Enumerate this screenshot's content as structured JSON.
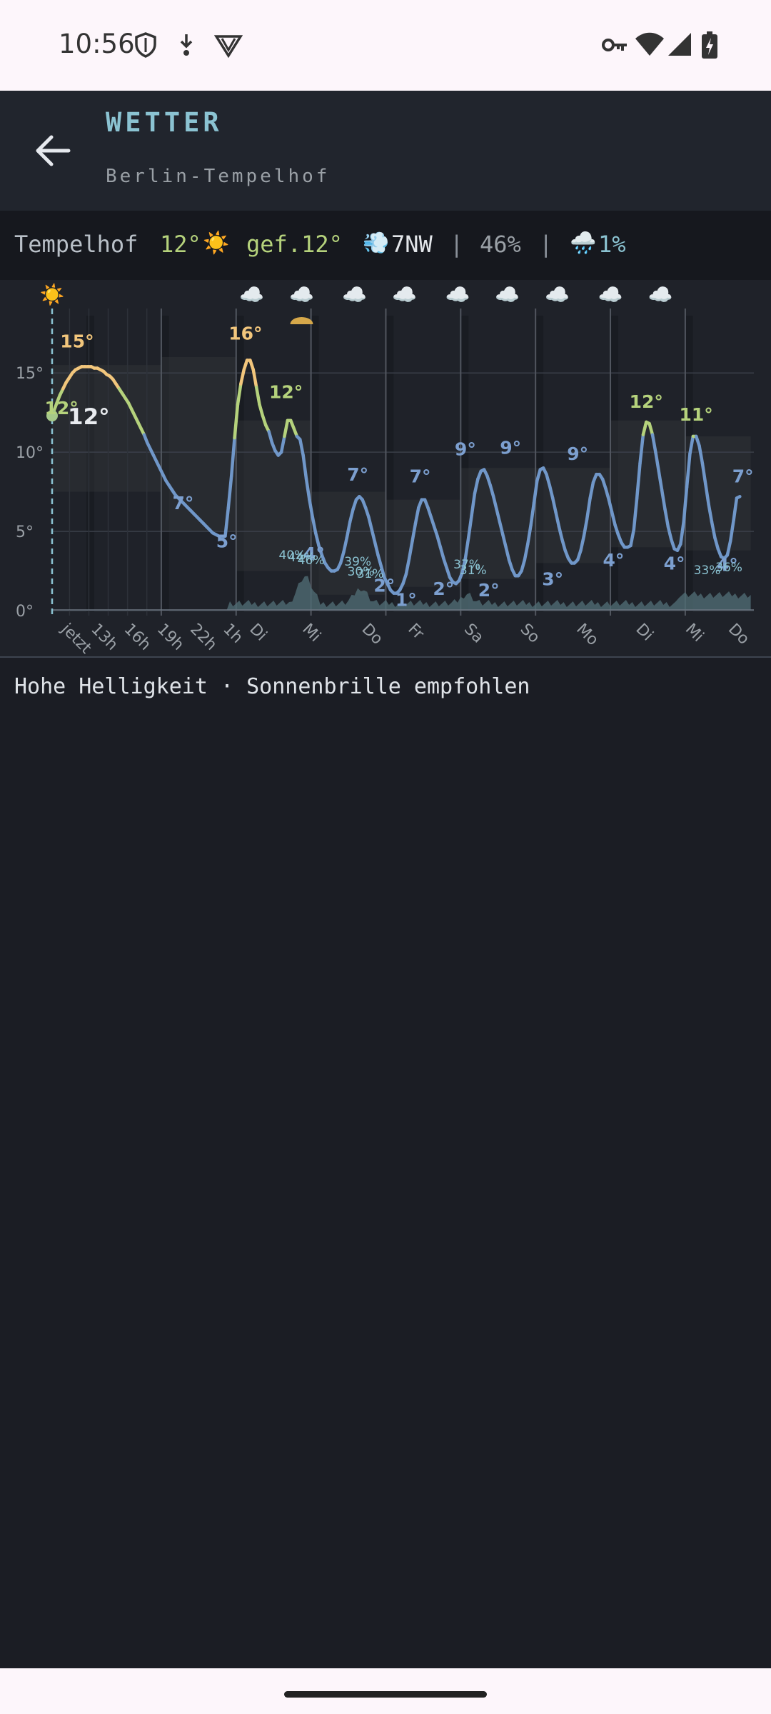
{
  "status_bar": {
    "time": "10:56"
  },
  "app_bar": {
    "title": "WETTER",
    "subtitle": "Berlin-Tempelhof"
  },
  "summary": {
    "location": "Tempelhof",
    "temperature": "12°",
    "condition_icon": "☀️",
    "feels_like": "gef.12°",
    "wind_icon": "💨",
    "wind": "7NW",
    "sep1": "|",
    "humidity": "46%",
    "sep2": "|",
    "rain_icon": "🌧️",
    "precipitation": "1%"
  },
  "advice": "Hohe Helligkeit · Sonnenbrille empfohlen",
  "colors": {
    "background": "#1b1d24",
    "accent": "#8bc3d2",
    "warm": "#f2c67c",
    "mild": "#b5d27c",
    "cool": "#7097c9"
  },
  "chart_data": {
    "type": "line",
    "ylim": [
      -1,
      17
    ],
    "y_ticks": [
      "15°",
      "10°",
      "5°",
      "0°"
    ],
    "x_ticks": [
      "jetzt",
      "13h",
      "16h",
      "19h",
      "22h",
      "1h",
      "Di",
      "Mi",
      "Do",
      "Fr",
      "Sa",
      "So",
      "Mo",
      "Di",
      "Mi",
      "Do"
    ],
    "temperature": {
      "x": [
        0,
        1.5,
        2.5,
        3.5,
        4.5,
        5.5,
        6.5,
        7.5,
        8.5,
        9.5,
        10.5,
        11.5,
        12.5,
        13.5,
        14.5,
        15.5,
        16.5,
        17.5,
        18.5,
        19.5,
        20.5,
        21.5,
        22.5,
        23.5,
        24.5,
        25.5,
        26.5,
        27.5,
        28.5,
        29.5,
        30.5,
        31.5,
        32.5,
        33.5,
        34.5,
        35.5,
        36.5,
        37.5,
        38.5,
        39.5,
        40.5,
        41.5,
        42.5,
        43.5,
        44.5,
        45.5,
        46.5,
        47.5,
        48.5,
        49.5,
        50.5,
        51.5,
        52.5,
        53.5,
        54.5,
        55.5,
        56.5,
        57.5,
        58.5,
        59.5,
        60.5,
        61.5,
        62.5,
        63.5,
        64.5,
        65.5,
        66.5,
        67.5,
        68.5,
        69.5,
        70.5,
        71.5,
        72.5,
        73.5,
        74.5,
        75.5,
        76.5,
        77.5,
        78.5,
        79.5,
        80.5,
        81.5,
        82.5,
        83.5,
        84.5,
        85.5,
        86.5,
        87.5,
        88.5,
        89.5,
        90.5,
        91.5,
        92.5,
        93.5,
        94.5,
        95.5,
        96.5,
        97.5,
        98.5,
        99.5,
        100.5,
        101.5,
        102.5,
        103.5,
        104.5,
        105.5,
        106.5,
        107.5,
        108.5,
        109.5,
        110.5,
        111.5,
        112.5,
        113.5,
        114.5,
        115.5,
        116.5,
        117.5,
        118.5,
        119.5,
        120.5,
        121.5,
        122.5,
        123.5,
        124.5,
        125.5,
        126.5,
        127.5,
        128.5,
        129.5,
        130.5,
        131.5,
        132.5,
        133.5,
        134.5,
        135.5,
        136.5,
        137.5,
        138.5,
        139.5,
        140.5,
        141.5,
        142.5,
        143.5,
        144.5,
        145.5,
        146.5,
        147.5,
        148.5,
        149.5,
        150.5,
        151.5,
        152.5,
        153.5,
        154.5,
        155.5,
        156.5,
        157.5,
        158.5,
        159.5,
        160.5,
        161.5,
        162.5,
        163.5,
        164.5,
        165.5,
        166.5,
        167.5,
        168.5,
        169.5,
        170.5,
        171.5,
        172.5,
        173.5,
        174.5,
        175.5,
        176.5,
        177.5,
        178.5,
        179.5,
        180.5,
        181.5,
        182.5,
        183.5,
        184.5,
        185.5,
        186.5,
        187.5,
        188.5,
        189.5,
        190.5,
        191.5,
        192.5,
        193.5,
        194.5,
        195.5,
        196.5,
        197.5,
        198.5,
        199.5,
        200.5,
        201.5,
        202.5,
        203.5,
        204.5,
        205.5,
        206.5,
        207.5,
        208.5,
        209.5,
        210.5,
        211.5,
        212.5,
        213.5,
        214.5,
        215.5,
        216.5,
        217.5,
        218.5,
        219.5,
        220.5,
        221.5,
        222.5,
        223.5,
        224.5,
        225.5,
        226.5,
        227.5,
        228.5,
        229.5,
        230.5,
        231.5,
        232.5,
        233.5,
        234.5,
        235.5,
        236.5,
        237.5,
        238.5,
        239.5,
        240.5,
        241.5,
        242.5,
        243.5,
        244.5,
        245.5,
        246.5,
        247.5,
        248.5,
        249.5,
        250.5,
        251.5,
        252.5,
        253.5,
        254.5,
        255.5,
        256.5,
        257.5,
        258.5,
        259.5,
        260.5,
        261.5,
        262.5,
        263.5,
        264.5,
        265.5,
        266.5,
        267.5,
        268.5,
        269.5,
        270.5,
        271.5,
        272.5,
        273.5,
        274.5,
        275.5,
        276.5,
        277.5,
        278.5,
        279.5,
        280.5,
        281.5,
        282.5,
        283.5,
        284.5,
        285.5,
        286.5,
        287.5,
        288.5,
        289.5,
        290.5,
        291.5,
        292.5,
        293.5,
        294.5,
        295.5,
        296.5,
        297.5,
        298.5,
        299.5,
        300.5,
        301.5,
        302.5,
        303.5,
        304.5,
        305.5,
        306.5,
        307.5,
        308.5,
        309.5,
        310.5,
        311.5,
        312.5,
        313.5,
        314.5,
        315.5,
        316.5,
        317.5,
        318.5,
        319.5,
        320.5,
        321.5,
        322.5,
        323.5,
        324.5,
        325.5,
        326.5,
        327.5,
        328.5,
        329.5,
        330.5,
        331.5,
        332.5,
        333.5,
        334.5,
        335.5,
        336.5,
        337.5,
        338.5,
        339.5,
        340.5,
        341.5,
        342.5,
        343.5,
        344.5,
        345.5,
        346.5,
        347.5,
        348.5,
        349.5,
        350.5,
        351.5,
        352.5,
        353.5,
        354.5,
        355.5,
        356.5,
        357.5,
        358.5,
        359.5,
        360.5,
        361.5,
        362.5,
        363.5,
        364.5,
        365.5,
        366.5,
        367.5,
        368.5,
        369.5,
        370.5,
        371.5,
        372.5,
        373.5,
        374.5,
        375.5,
        376.5,
        377.5,
        378.5,
        379.5,
        380.5,
        381.5,
        382.5,
        383.5,
        384.5,
        385.5,
        386.5,
        387.5,
        388.5,
        389.5,
        390.5,
        391.5,
        392.5,
        393.5,
        394.5,
        395.5,
        396.5,
        397.5,
        398.5,
        399.5,
        400.5,
        401.5,
        402.5,
        403.5,
        404.5,
        405.5,
        406.5,
        407.5,
        408.5,
        409.5,
        410.5,
        411.5,
        412.5,
        413.5,
        414.5,
        415.5,
        416.5,
        417.5,
        418.5,
        419.5,
        420.5,
        421.5,
        422.5,
        423.5,
        424.5,
        425.5,
        426.5,
        427.5,
        428.5,
        429.5,
        430.5,
        431.5,
        432.5,
        433.5,
        434.5,
        435.5,
        436.5,
        437.5,
        438.5,
        439.5,
        440.5,
        441.5,
        442.5,
        443.5,
        444.5,
        445.5,
        446.5,
        447.5,
        448.5,
        449.5,
        450.5,
        451.5,
        452.5,
        453.5,
        454.5,
        455.5,
        456.5,
        457.5,
        458.5,
        459.5,
        460.5,
        461.5,
        462.5,
        463.5,
        464.5,
        465.5,
        466.5,
        467.5,
        468.5,
        469.5,
        470.5,
        471.5,
        472.5,
        473.5,
        474.5,
        475.5,
        476.5,
        477.5,
        478.5,
        479.5,
        480.5,
        481.5,
        482.5,
        483.5,
        484.5,
        485.5,
        486.5,
        487.5,
        488.5,
        489.5,
        490.5,
        491.5,
        492.5,
        493.5,
        494.5,
        495.5,
        496.5,
        497.5,
        498.5,
        499.5,
        500.5,
        501.5,
        502.5,
        503.5,
        504.5,
        505.5,
        506.5,
        507.5,
        508.5,
        509.5,
        510.5,
        511.5,
        512.5,
        513.5,
        514.5,
        515.5,
        516.5,
        517.5,
        518.5,
        519.5,
        520.5,
        521.5,
        522.5,
        523.5,
        524.5,
        525.5,
        526.5,
        527.5,
        528.5,
        529.5,
        530.5,
        531.5,
        532.5,
        533.5,
        534.5,
        535.5,
        536.5,
        537.5,
        538.5,
        539.5,
        540.5,
        541.5,
        542.5,
        543.5,
        544.5,
        545.5,
        546.5,
        547.5,
        548.5,
        549.5,
        550.5,
        551.5,
        552.5,
        553.5,
        554.5,
        555.5,
        556.5,
        557.5,
        558.5,
        559.5,
        560.5,
        561.5,
        562.5,
        563.5,
        564.5,
        565.5,
        566.5,
        567.5,
        568.5,
        569.5,
        570.5,
        571.5,
        572.5,
        573.5,
        574.5,
        575.5,
        576.5,
        577.5,
        578.5,
        579.5,
        580.5,
        581.5,
        582.5,
        583.5,
        584.5,
        585.5,
        586.5,
        587.5,
        588.5,
        589.5,
        590.5,
        591.5,
        592.5,
        593.5,
        594.5,
        595.5,
        596.5,
        597.5,
        598.5,
        599.5,
        600.5,
        601.5,
        602.5,
        603.5,
        604.5,
        605.5,
        606.5,
        607.5,
        608.5,
        609.5,
        610.5,
        611.5,
        612.5,
        613.5,
        614.5,
        615.5,
        616.5,
        617.5,
        618.5,
        619.5,
        620.5,
        621.5,
        622.5,
        623.5,
        624.5,
        625.5,
        626.5,
        627.5,
        628.5,
        629.5,
        630.5,
        631.5,
        632.5,
        633.5,
        634.5,
        635.5,
        636.5,
        637.5,
        638.5,
        639.5
      ],
      "y": [
        12.3,
        13.1,
        13.6,
        14.0,
        14.4,
        14.7,
        15.0,
        15.2,
        15.3,
        15.4,
        15.4,
        15.4,
        15.4,
        15.3,
        15.3,
        15.2,
        15.1,
        14.9,
        14.8,
        14.6,
        14.3,
        14.0,
        13.7,
        13.4,
        13.1,
        12.7,
        12.3,
        11.9,
        11.5,
        11.1,
        10.6,
        10.2,
        9.8,
        9.4,
        9.0,
        8.6,
        8.2,
        7.9,
        7.6,
        7.3,
        7.1,
        6.9,
        6.7,
        6.5,
        6.3,
        6.1,
        5.9,
        5.7,
        5.5,
        5.3,
        5.1,
        4.9,
        4.8,
        4.7,
        4.6,
        4.7,
        6.5,
        8.5,
        10.9,
        13.0,
        14.3,
        15.2,
        15.8,
        15.8,
        15.2,
        14.1,
        13.0,
        12.3,
        11.7,
        11.3,
        10.6,
        10.1,
        9.8,
        10.0,
        11.0,
        12.0,
        12.0,
        11.5,
        11.0,
        10.8,
        9.8,
        8.3,
        7.0,
        5.9,
        4.9,
        4.1,
        3.5,
        3.0,
        2.7,
        2.5,
        2.5,
        2.6,
        3.0,
        3.7,
        4.6,
        5.6,
        6.4,
        7.0,
        7.2,
        7.0,
        6.5,
        5.9,
        5.1,
        4.3,
        3.5,
        2.8,
        2.1,
        1.7,
        1.3,
        1.1,
        1.1,
        1.3,
        1.7,
        2.3,
        3.3,
        4.4,
        5.5,
        6.5,
        7.0,
        7.0,
        6.5,
        5.9,
        5.3,
        4.7,
        4.0,
        3.3,
        2.7,
        2.1,
        1.8,
        1.7,
        1.9,
        2.4,
        3.3,
        4.6,
        6.0,
        7.4,
        8.3,
        8.8,
        8.9,
        8.5,
        7.9,
        7.2,
        6.4,
        5.6,
        4.8,
        4.0,
        3.2,
        2.6,
        2.2,
        2.2,
        2.5,
        3.2,
        4.2,
        5.4,
        6.8,
        8.2,
        8.9,
        9.0,
        8.6,
        7.9,
        7.1,
        6.2,
        5.3,
        4.5,
        3.8,
        3.3,
        3.0,
        3.0,
        3.2,
        3.8,
        4.7,
        5.8,
        7.1,
        8.1,
        8.6,
        8.6,
        8.3,
        7.7,
        7.0,
        6.2,
        5.4,
        4.8,
        4.3,
        4.0,
        4.0,
        4.1,
        5.1,
        7.1,
        9.3,
        11.1,
        11.9,
        11.8,
        11.1,
        10.0,
        8.8,
        7.6,
        6.4,
        5.3,
        4.5,
        3.9,
        3.8,
        4.2,
        5.6,
        7.8,
        9.9,
        11.0,
        11.0,
        10.4,
        9.3,
        8.0,
        6.7,
        5.6,
        4.6,
        3.9,
        3.4,
        3.3,
        3.5,
        4.4,
        5.7,
        7.1,
        7.2
      ],
      "_note": "x = hours from now"
    },
    "temperature_labels": [
      {
        "text": "15°",
        "x": 8.0,
        "y": 16.6
      },
      {
        "text": "12°",
        "x": 3.0,
        "y": 12.4
      },
      {
        "text": "7°",
        "x": 42.0,
        "y": 6.4
      },
      {
        "text": "5°",
        "x": 56.0,
        "y": 4.0
      },
      {
        "text": "16°",
        "x": 62.0,
        "y": 17.1
      },
      {
        "text": "12°",
        "x": 75.0,
        "y": 13.4
      },
      {
        "text": "4°",
        "x": 84.0,
        "y": 3.2
      },
      {
        "text": "7°",
        "x": 98.0,
        "y": 8.2
      },
      {
        "text": "2°",
        "x": 106.5,
        "y": 1.2
      },
      {
        "text": "1°",
        "x": 113.5,
        "y": 0.3
      },
      {
        "text": "7°",
        "x": 118.0,
        "y": 8.1
      },
      {
        "text": "2°",
        "x": 125.5,
        "y": 1.0
      },
      {
        "text": "9°",
        "x": 132.5,
        "y": 9.8
      },
      {
        "text": "2°",
        "x": 140.0,
        "y": 0.9
      },
      {
        "text": "9°",
        "x": 147.0,
        "y": 9.9
      },
      {
        "text": "3°",
        "x": 160.5,
        "y": 1.6
      },
      {
        "text": "9°",
        "x": 168.5,
        "y": 9.5
      },
      {
        "text": "4°",
        "x": 180.0,
        "y": 2.8
      },
      {
        "text": "12°",
        "x": 190.5,
        "y": 12.8
      },
      {
        "text": "4°",
        "x": 199.5,
        "y": 2.6
      },
      {
        "text": "11°",
        "x": 206.5,
        "y": 12.0
      },
      {
        "text": "4°",
        "x": 216.5,
        "y": 2.5
      },
      {
        "text": "7°",
        "x": 221.5,
        "y": 8.1
      }
    ],
    "precipitation_labels": [
      "40%",
      "44%",
      "46%",
      "39%",
      "30%",
      "31%",
      "37%",
      "31%",
      "33%",
      "36%"
    ],
    "weather_icons": [
      {
        "x": 0,
        "icon": "☀️"
      },
      {
        "x": 64,
        "icon": "☁️"
      },
      {
        "x": 80,
        "icon": "☁️"
      },
      {
        "x": 97,
        "icon": "☁️"
      },
      {
        "x": 113,
        "icon": "☁️"
      },
      {
        "x": 130,
        "icon": "☁️"
      },
      {
        "x": 146,
        "icon": "☁️"
      },
      {
        "x": 162,
        "icon": "☁️"
      },
      {
        "x": 179,
        "icon": "☁️"
      },
      {
        "x": 195,
        "icon": "☁️"
      }
    ],
    "now_label": "12°",
    "grid": true
  }
}
